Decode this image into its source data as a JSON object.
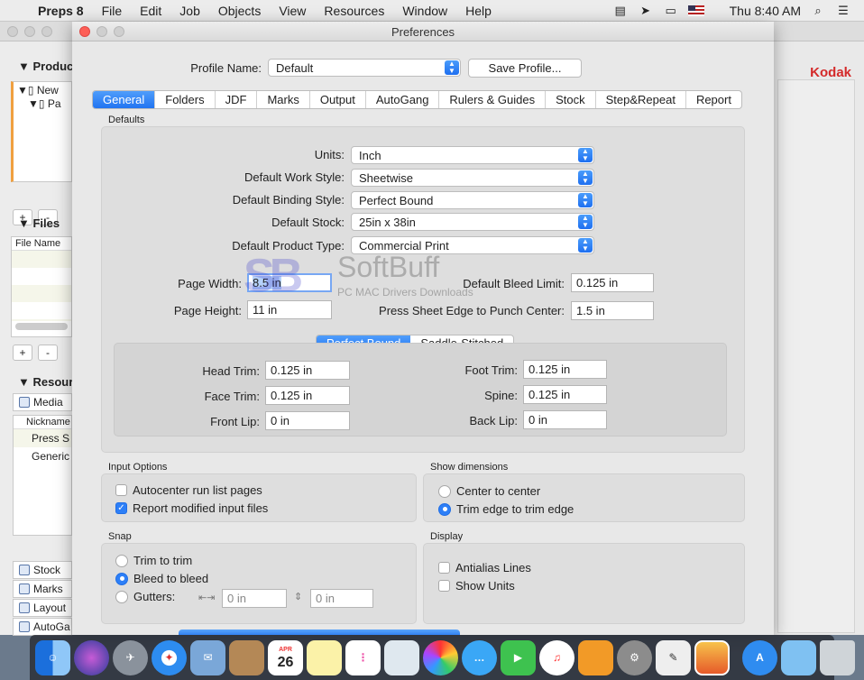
{
  "menubar": {
    "app": "Preps 8",
    "items": [
      "File",
      "Edit",
      "Job",
      "Objects",
      "View",
      "Resources",
      "Window",
      "Help"
    ],
    "clock": "Thu 8:40 AM"
  },
  "bg": {
    "brand": "Kodak",
    "sections": {
      "products": "Produc",
      "files": "Files",
      "resources": "Resour"
    },
    "tree": [
      "New",
      "Pa"
    ],
    "files_header": "File Name",
    "res_media": "Media",
    "res_header": "Nickname",
    "res_rows": [
      "Press S",
      "Generic"
    ],
    "res_tabs": [
      "Stock",
      "Marks",
      "Layout",
      "AutoGa"
    ],
    "plus": "+",
    "minus": "-"
  },
  "prefs": {
    "title": "Preferences",
    "profile_label": "Profile Name:",
    "profile_value": "Default",
    "save_profile": "Save Profile...",
    "tabs": [
      "General",
      "Folders",
      "JDF",
      "Marks",
      "Output",
      "AutoGang",
      "Rulers & Guides",
      "Stock",
      "Step&Repeat",
      "Report"
    ],
    "defaults_title": "Defaults",
    "units_label": "Units:",
    "units_value": "Inch",
    "work_style_label": "Default Work Style:",
    "work_style_value": "Sheetwise",
    "binding_label": "Default Binding Style:",
    "binding_value": "Perfect Bound",
    "stock_label": "Default Stock:",
    "stock_value": "25in x 38in",
    "product_type_label": "Default Product Type:",
    "product_type_value": "Commercial Print",
    "page_width_label": "Page Width:",
    "page_width_value": "8.5 in",
    "page_height_label": "Page Height:",
    "page_height_value": "11 in",
    "bleed_label": "Default Bleed Limit:",
    "bleed_value": "0.125 in",
    "punch_label": "Press Sheet Edge to Punch Center:",
    "punch_value": "1.5 in",
    "binding_seg": [
      "Perfect Bound",
      "Saddle-Stitched"
    ],
    "head_trim_label": "Head Trim:",
    "head_trim_value": "0.125 in",
    "face_trim_label": "Face Trim:",
    "face_trim_value": "0.125 in",
    "front_lip_label": "Front Lip:",
    "front_lip_value": "0 in",
    "foot_trim_label": "Foot Trim:",
    "foot_trim_value": "0.125 in",
    "spine_label": "Spine:",
    "spine_value": "0.125 in",
    "back_lip_label": "Back Lip:",
    "back_lip_value": "0 in",
    "input_options_title": "Input Options",
    "autocenter_label": "Autocenter run list pages",
    "report_modified_label": "Report modified input files",
    "show_dimensions_title": "Show dimensions",
    "center_to_center_label": "Center to center",
    "trim_edge_label": "Trim edge to trim edge",
    "snap_title": "Snap",
    "trim_to_trim_label": "Trim to trim",
    "bleed_to_bleed_label": "Bleed to bleed",
    "gutters_label": "Gutters:",
    "gutter_h_value": "0 in",
    "gutter_v_value": "0 in",
    "display_title": "Display",
    "antialias_label": "Antialias Lines",
    "show_units_label": "Show Units"
  },
  "watermark": {
    "logo": "SB",
    "name": "SoftBuff",
    "tagline": "PC MAC Drivers Downloads"
  },
  "dock": {
    "calendar_month": "APR",
    "calendar_day": "26"
  },
  "colors": {
    "accent": "#2174f1",
    "kodak": "#d42a2a"
  }
}
